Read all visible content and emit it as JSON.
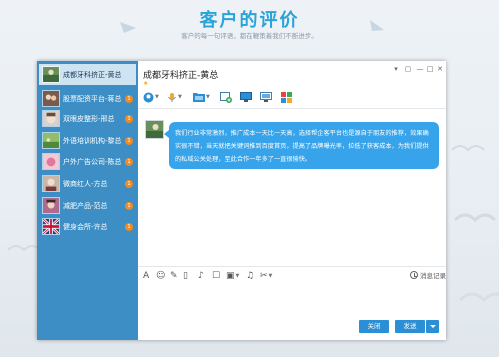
{
  "page": {
    "title": "客户的评价",
    "subtitle": "客户的每一句评语，都在鞭策着我们不断进步。"
  },
  "window": {
    "chat_title": "成都牙科挤正-黄总",
    "controls": [
      "▾",
      "▢",
      "—",
      "□",
      "✕"
    ]
  },
  "contacts": [
    {
      "name": "成都牙科挤正-黄总",
      "badge": "",
      "active": true
    },
    {
      "name": "股票配资平台-蒋总",
      "badge": "1"
    },
    {
      "name": "双眼皮整形-邢总",
      "badge": "1"
    },
    {
      "name": "外语培训机构-黎总",
      "badge": "1"
    },
    {
      "name": "户外广告公司-陈总",
      "badge": "1"
    },
    {
      "name": "微商红人-方总",
      "badge": "1"
    },
    {
      "name": "减肥产品-范总",
      "badge": "1"
    },
    {
      "name": "健身会所-许总",
      "badge": "1"
    }
  ],
  "message": {
    "text": "我们行业非常激烈，推广成本一天比一天高，选择帮企客平台也是源自于朋友的推荐，效果确实很不错，当天就把关键词推到百度首页，提高了品牌曝光率，拉低了获客成本，为我们提供的私域公关处理，至此合作一年多了一直很愉快。"
  },
  "input_toolbar": {
    "history_label": "消息记录"
  },
  "buttons": {
    "close_label": "关闭",
    "send_label": "发送"
  },
  "colors": {
    "accent": "#2aa3d9",
    "sidebar": "#3d8ec4",
    "bubble": "#36a3ea",
    "badge": "#f08a24",
    "button": "#2b8fd6"
  }
}
